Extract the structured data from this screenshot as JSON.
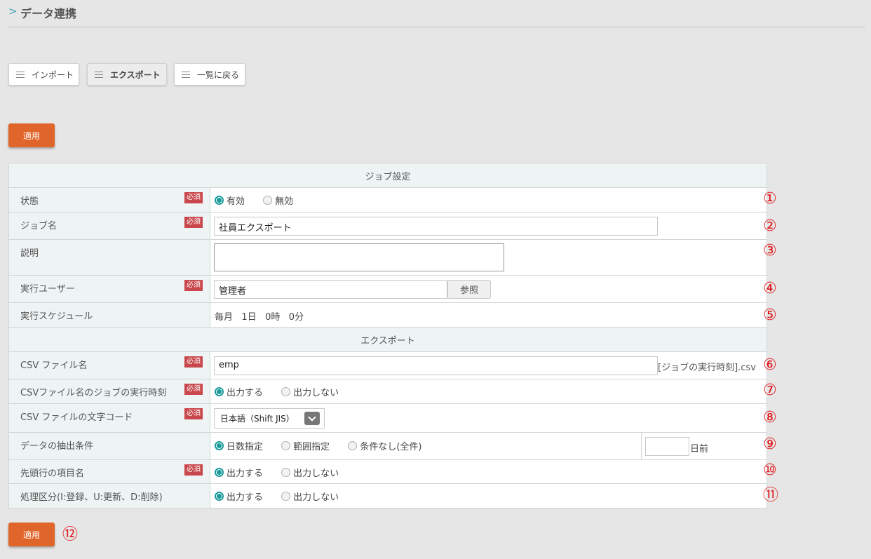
{
  "header": {
    "title": "データ連携"
  },
  "tabs": [
    {
      "label": "インポート"
    },
    {
      "label": "エクスポート"
    },
    {
      "label": "一覧に戻る"
    }
  ],
  "apply_label": "適用",
  "required_label": "必須",
  "section_job": "ジョブ設定",
  "section_export": "エクスポート",
  "status": {
    "label": "状態",
    "opt_enabled": "有効",
    "opt_disabled": "無効"
  },
  "job_name": {
    "label": "ジョブ名",
    "value": "社員エクスポート"
  },
  "description": {
    "label": "説明",
    "value": ""
  },
  "exec_user": {
    "label": "実行ユーザー",
    "value": "管理者",
    "browse": "参照"
  },
  "schedule": {
    "label": "実行スケジュール",
    "monthly": "毎月",
    "day": "1日",
    "hour": "0時",
    "minute": "0分"
  },
  "csv_name": {
    "label": "CSV ファイル名",
    "value": "emp",
    "suffix": "[ジョブの実行時刻].csv"
  },
  "csv_time": {
    "label": "CSVファイル名のジョブの実行時刻",
    "opt_yes": "出力する",
    "opt_no": "出力しない"
  },
  "csv_encoding": {
    "label": "CSV ファイルの文字コード",
    "selected": "日本語（Shift JIS）"
  },
  "extract": {
    "label": "データの抽出条件",
    "opt_days": "日数指定",
    "opt_range": "範囲指定",
    "opt_none": "条件なし(全件)",
    "days_value": "",
    "days_suffix": "日前"
  },
  "header_row": {
    "label": "先頭行の項目名",
    "opt_yes": "出力する",
    "opt_no": "出力しない"
  },
  "process_type": {
    "label": "処理区分(I:登録、U:更新、D:削除)",
    "opt_yes": "出力する",
    "opt_no": "出力しない"
  },
  "markers": [
    "①",
    "②",
    "③",
    "④",
    "⑤",
    "⑥",
    "⑦",
    "⑧",
    "⑨",
    "⑩",
    "⑪",
    "⑫"
  ]
}
